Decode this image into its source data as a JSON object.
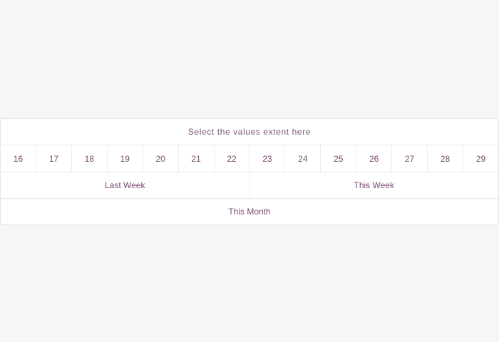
{
  "selector": {
    "title": "Select the values extent here",
    "days": [
      "16",
      "17",
      "18",
      "19",
      "20",
      "21",
      "22",
      "23",
      "24",
      "25",
      "26",
      "27",
      "28",
      "29"
    ],
    "weeks": [
      "Last Week",
      "This Week"
    ],
    "month": "This Month"
  },
  "colors": {
    "background": "#f6f6f6",
    "panel": "#ffffff",
    "text": "#7b4a74",
    "border": "#e5e5e5"
  }
}
